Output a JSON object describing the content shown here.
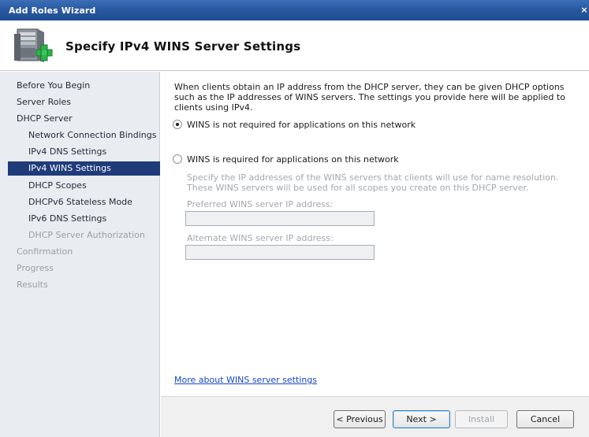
{
  "window": {
    "title": "Add Roles Wizard",
    "close_glyph": "×"
  },
  "header": {
    "title": "Specify IPv4 WINS Server Settings",
    "icon": "server-add-icon"
  },
  "nav": {
    "items": [
      {
        "label": "Before You Begin"
      },
      {
        "label": "Server Roles"
      },
      {
        "label": "DHCP Server"
      },
      {
        "label": "Network Connection Bindings"
      },
      {
        "label": "IPv4 DNS Settings"
      },
      {
        "label": "IPv4 WINS Settings"
      },
      {
        "label": "DHCP Scopes"
      },
      {
        "label": "DHCPv6 Stateless Mode"
      },
      {
        "label": "IPv6 DNS Settings"
      },
      {
        "label": "DHCP Server Authorization"
      },
      {
        "label": "Confirmation"
      },
      {
        "label": "Progress"
      },
      {
        "label": "Results"
      }
    ],
    "active_label": "IPv4 WINS Settings"
  },
  "main": {
    "description": "When clients obtain an IP address from the DHCP server, they can be given DHCP options such as the IP addresses of WINS servers. The settings you provide here will be applied to clients using IPv4.",
    "option_not_required": "WINS is not required for applications on this network",
    "option_required": "WINS is required for applications on this network",
    "selected_option": "WINS is not required for applications on this network",
    "required_hint": "Specify the IP addresses of the WINS servers that clients will use for name resolution. These WINS servers will be used for all scopes you create on this DHCP server.",
    "preferred_label": "Preferred WINS server IP address:",
    "preferred_value": "",
    "alternate_label": "Alternate WINS server IP address:",
    "alternate_value": "",
    "more_link": "More about WINS server settings"
  },
  "footer": {
    "previous": "< Previous",
    "next": "Next >",
    "install": "Install",
    "cancel": "Cancel"
  },
  "colors": {
    "title_bar": "#2a5aa2",
    "nav_selected_bg": "#1f3b7a",
    "link": "#1846c8",
    "sidebar_bg": "#e9ecf0"
  }
}
